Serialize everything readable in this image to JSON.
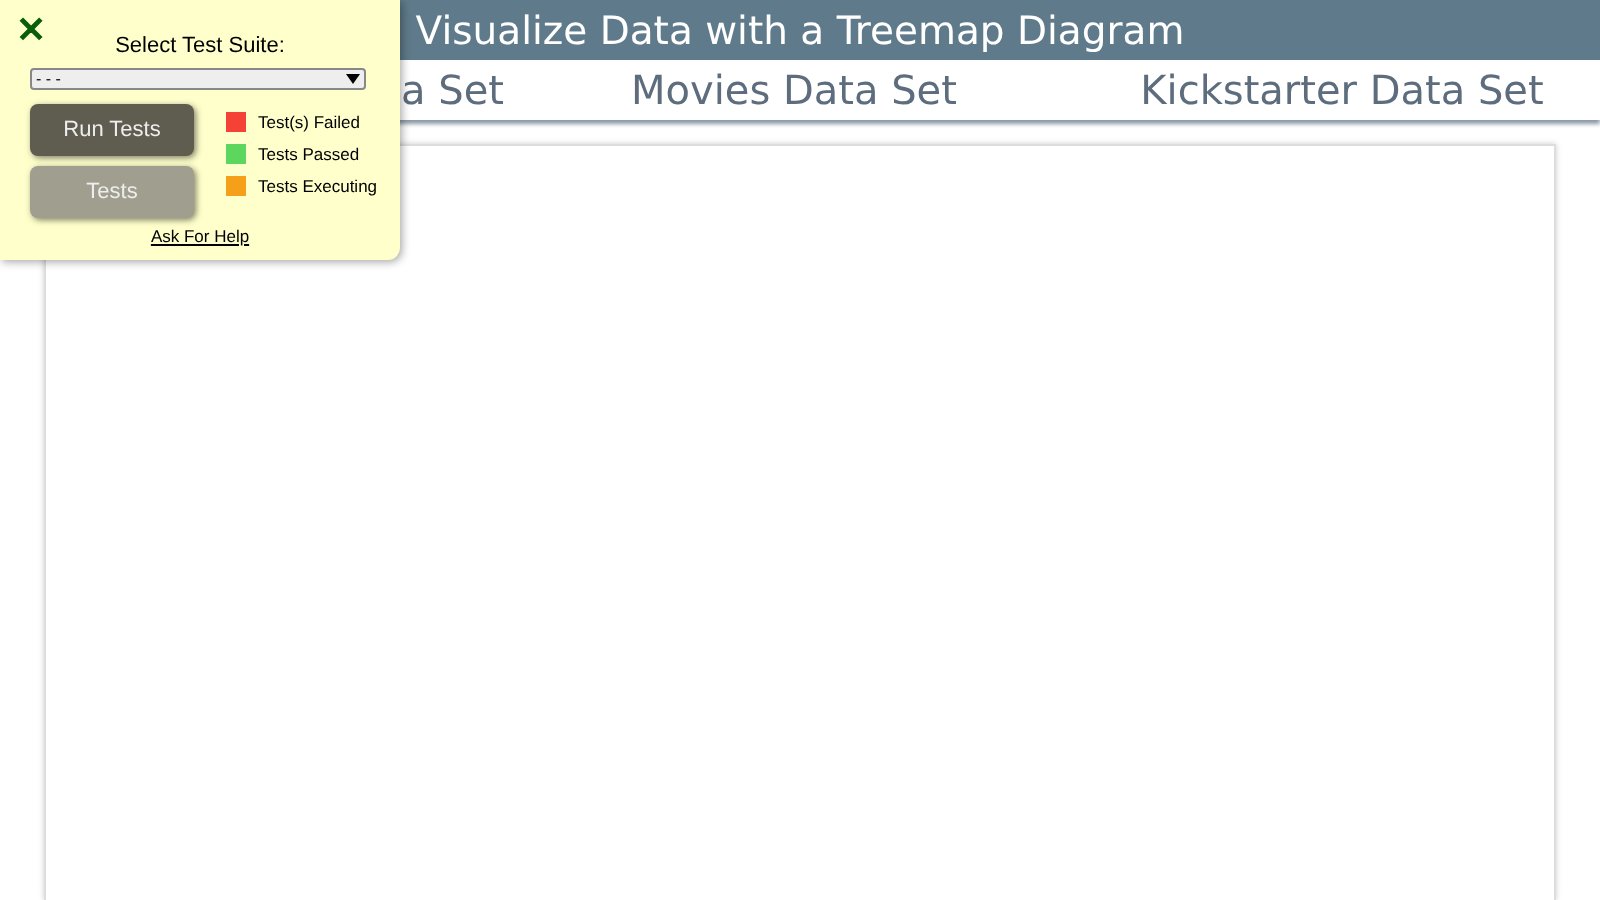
{
  "header": {
    "title": "Visualize Data with a Treemap Diagram"
  },
  "nav": [
    {
      "label": "a Set"
    },
    {
      "label": "Movies Data Set"
    },
    {
      "label": "Kickstarter Data Set"
    }
  ],
  "test_panel": {
    "close": "✕",
    "title": "Select Test Suite:",
    "select_value": "- - -",
    "run_button": "Run Tests",
    "tests_button": "Tests",
    "legend": [
      {
        "label": "Test(s) Failed",
        "color": "#f44336"
      },
      {
        "label": "Tests Passed",
        "color": "#5cd65c"
      },
      {
        "label": "Tests Executing",
        "color": "#f6a01a"
      }
    ],
    "help_link": "Ask For Help"
  }
}
